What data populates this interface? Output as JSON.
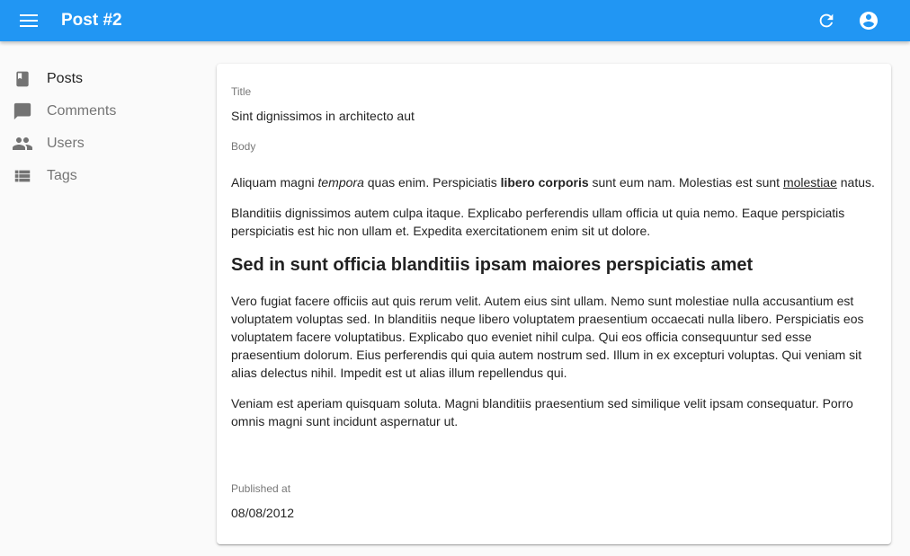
{
  "appbar": {
    "title": "Post #2",
    "menu_icon": "menu-icon",
    "refresh_icon": "refresh-icon",
    "account_icon": "account-circle-icon",
    "color": "#2196f3"
  },
  "sidebar": {
    "items": [
      {
        "label": "Posts",
        "icon": "book-icon",
        "active": true
      },
      {
        "label": "Comments",
        "icon": "comment-icon",
        "active": false
      },
      {
        "label": "Users",
        "icon": "people-icon",
        "active": false
      },
      {
        "label": "Tags",
        "icon": "list-icon",
        "active": false
      }
    ]
  },
  "post": {
    "title_label": "Title",
    "title_value": "Sint dignissimos in architecto aut",
    "body_label": "Body",
    "body": {
      "p1_a": "Aliquam magni ",
      "p1_em": "tempora",
      "p1_b": " quas enim. Perspiciatis ",
      "p1_strong": "libero corporis",
      "p1_c": " sunt eum nam. Molestias est sunt ",
      "p1_link": "molestiae",
      "p1_d": " natus.",
      "p2": "Blanditiis dignissimos autem culpa itaque. Explicabo perferendis ullam officia ut quia nemo. Eaque perspiciatis perspiciatis est hic non ullam et. Expedita exercitationem enim sit ut dolore.",
      "heading": "Sed in sunt officia blanditiis ipsam maiores perspiciatis amet",
      "p3": "Vero fugiat facere officiis aut quis rerum velit. Autem eius sint ullam. Nemo sunt molestiae nulla accusantium est voluptatem voluptas sed. In blanditiis neque libero voluptatem praesentium occaecati nulla libero. Perspiciatis eos voluptatem facere voluptatibus. Explicabo quo eveniet nihil culpa. Qui eos officia consequuntur sed esse praesentium dolorum. Eius perferendis qui quia autem nostrum sed. Illum in ex excepturi voluptas. Qui veniam sit alias delectus nihil. Impedit est ut alias illum repellendus qui.",
      "p4": "Veniam est aperiam quisquam soluta. Magni blanditiis praesentium sed similique velit ipsam consequatur. Porro omnis magni sunt incidunt aspernatur ut."
    },
    "published_label": "Published at",
    "published_value": "08/08/2012"
  }
}
